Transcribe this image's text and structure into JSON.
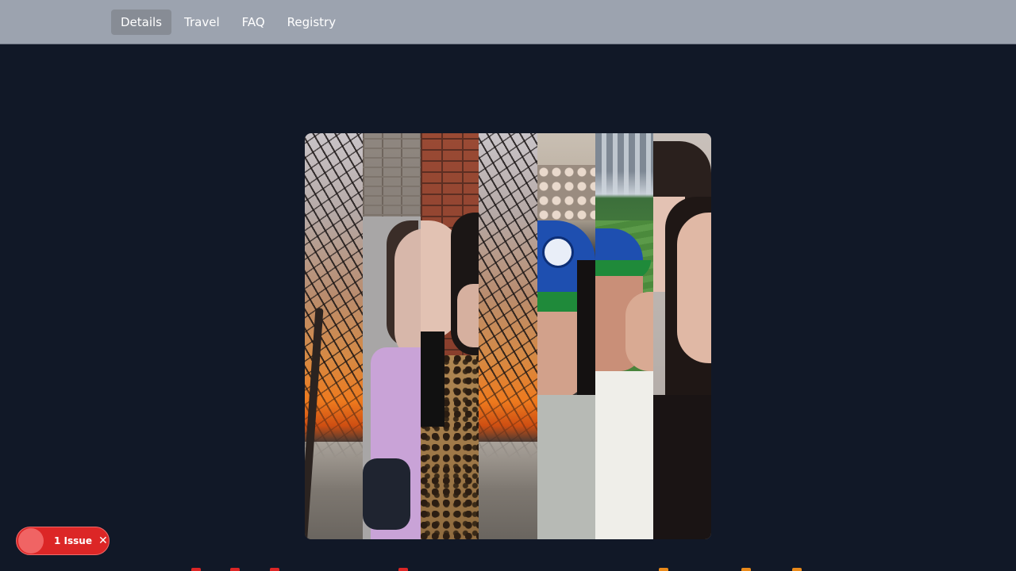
{
  "nav": {
    "items": [
      {
        "label": "Details",
        "active": true
      },
      {
        "label": "Travel",
        "active": false
      },
      {
        "label": "FAQ",
        "active": false
      },
      {
        "label": "Registry",
        "active": false
      }
    ],
    "background": "#9ca3af"
  },
  "page": {
    "background": "#111827"
  },
  "collage": {
    "strips": [
      "sunset-trees",
      "brick-wall-portrait",
      "red-brick-leopard-coat",
      "sunset-trees",
      "stadium-blue-cap-selfie",
      "baseball-field-selfie",
      "couple-closeup"
    ]
  },
  "issues_badge": {
    "label": "1 Issue",
    "close_icon": "close-icon",
    "color": "#dc2626"
  }
}
